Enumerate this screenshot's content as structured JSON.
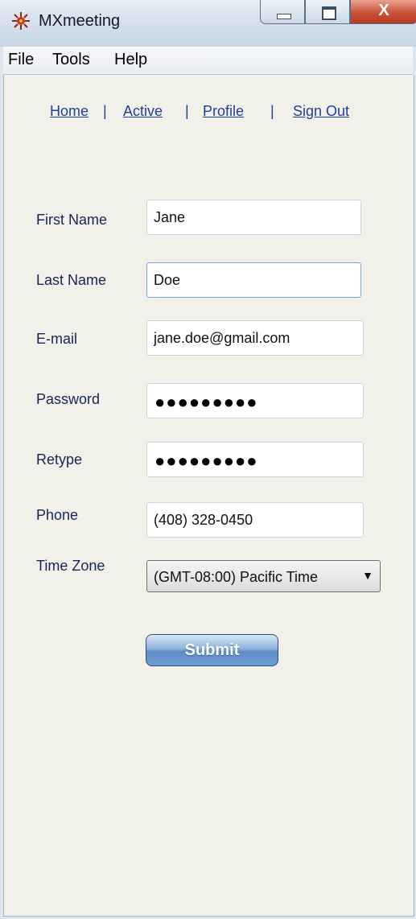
{
  "window": {
    "title": "MXmeeting",
    "controls": {
      "close_label": "X"
    }
  },
  "menu": {
    "items": [
      "File",
      "Tools",
      "Help"
    ]
  },
  "nav": {
    "links": [
      "Home",
      "Active",
      "Profile",
      "Sign Out"
    ],
    "separator": "|"
  },
  "form": {
    "first_name": {
      "label": "First Name",
      "value": "Jane"
    },
    "last_name": {
      "label": "Last Name",
      "value": "Doe"
    },
    "email": {
      "label": "E-mail",
      "value": "jane.doe@gmail.com"
    },
    "password": {
      "label": "Password",
      "masked": "●●●●●●●●●"
    },
    "retype": {
      "label": "Retype",
      "masked": "●●●●●●●●●"
    },
    "phone": {
      "label": "Phone",
      "value": "(408) 328-0450"
    },
    "time_zone": {
      "label": "Time Zone",
      "selected": "(GMT-08:00) Pacific Time"
    },
    "submit_label": "Submit"
  },
  "icons": {
    "app": "app-logo-icon",
    "dropdown": "chevron-down-icon"
  },
  "colors": {
    "link": "#1f3f9a",
    "label": "#19245a",
    "submit": "#5c8cc7",
    "close": "#c9523a"
  }
}
